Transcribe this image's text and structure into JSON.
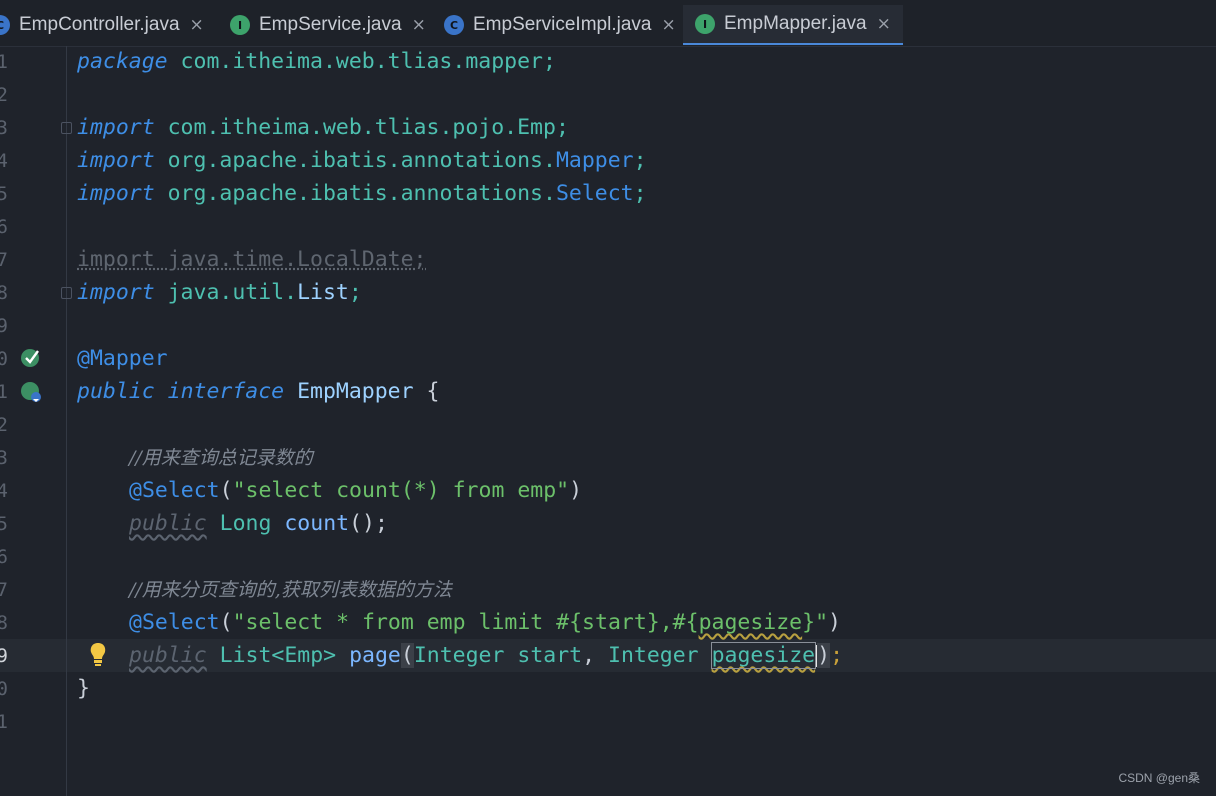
{
  "tabs": [
    {
      "label": "EmpController.java",
      "icon": "C"
    },
    {
      "label": "EmpService.java",
      "icon": "I"
    },
    {
      "label": "EmpServiceImpl.java",
      "icon": "C"
    },
    {
      "label": "EmpMapper.java",
      "icon": "I",
      "active": true
    }
  ],
  "close_glyph": "×",
  "line_numbers": [
    "1",
    "2",
    "3",
    "4",
    "5",
    "6",
    "7",
    "8",
    "9",
    "0",
    "1",
    "2",
    "3",
    "4",
    "5",
    "6",
    "7",
    "8",
    "9",
    "0",
    "1"
  ],
  "code": {
    "l1": {
      "kw": "package",
      "rest": " com.itheima.web.tlias.mapper;"
    },
    "l3": {
      "kw": "import",
      "rest": " com.itheima.web.tlias.pojo.Emp;"
    },
    "l4": {
      "kw": "import",
      "pkg": " org.apache.ibatis.annotations.",
      "cls": "Mapper",
      "end": ";"
    },
    "l5": {
      "kw": "import",
      "pkg": " org.apache.ibatis.annotations.",
      "cls": "Select",
      "end": ";"
    },
    "l7": {
      "text": "import java.time.LocalDate;"
    },
    "l8": {
      "kw": "import",
      "pkg": " java.util.",
      "cls": "List",
      "end": ";"
    },
    "l10": {
      "ann": "@Mapper"
    },
    "l11": {
      "kw1": "public",
      "kw2": "interface",
      "name": "EmpMapper",
      "brace": " {"
    },
    "l13": {
      "comment": "//用来查询总记录数的"
    },
    "l14": {
      "ann": "@Select",
      "open": "(",
      "str": "\"select count(*) from emp\"",
      "close": ")"
    },
    "l15": {
      "kw": "public",
      "type": "Long",
      "fn": "count",
      "end": "();"
    },
    "l17": {
      "comment": "//用来分页查询的,获取列表数据的方法"
    },
    "l18": {
      "ann": "@Select",
      "open": "(",
      "str1": "\"select * from emp limit #{start},#{",
      "strwarn": "pagesize",
      "str2": "}\"",
      "close": ")"
    },
    "l19": {
      "kw": "public",
      "type": "List<Emp>",
      "fn": "page",
      "p1type": "Integer",
      "p1": "start",
      "p2type": "Integer",
      "p2": "pagesize",
      "end": ";"
    },
    "l20": {
      "brace": "}"
    }
  },
  "watermark": "CSDN @gen桑",
  "colors": {
    "background": "#1f232b",
    "keyword": "#3e8ee6",
    "string": "#6cc06a",
    "comment": "#7f8793",
    "accent": "#4a88d9"
  }
}
